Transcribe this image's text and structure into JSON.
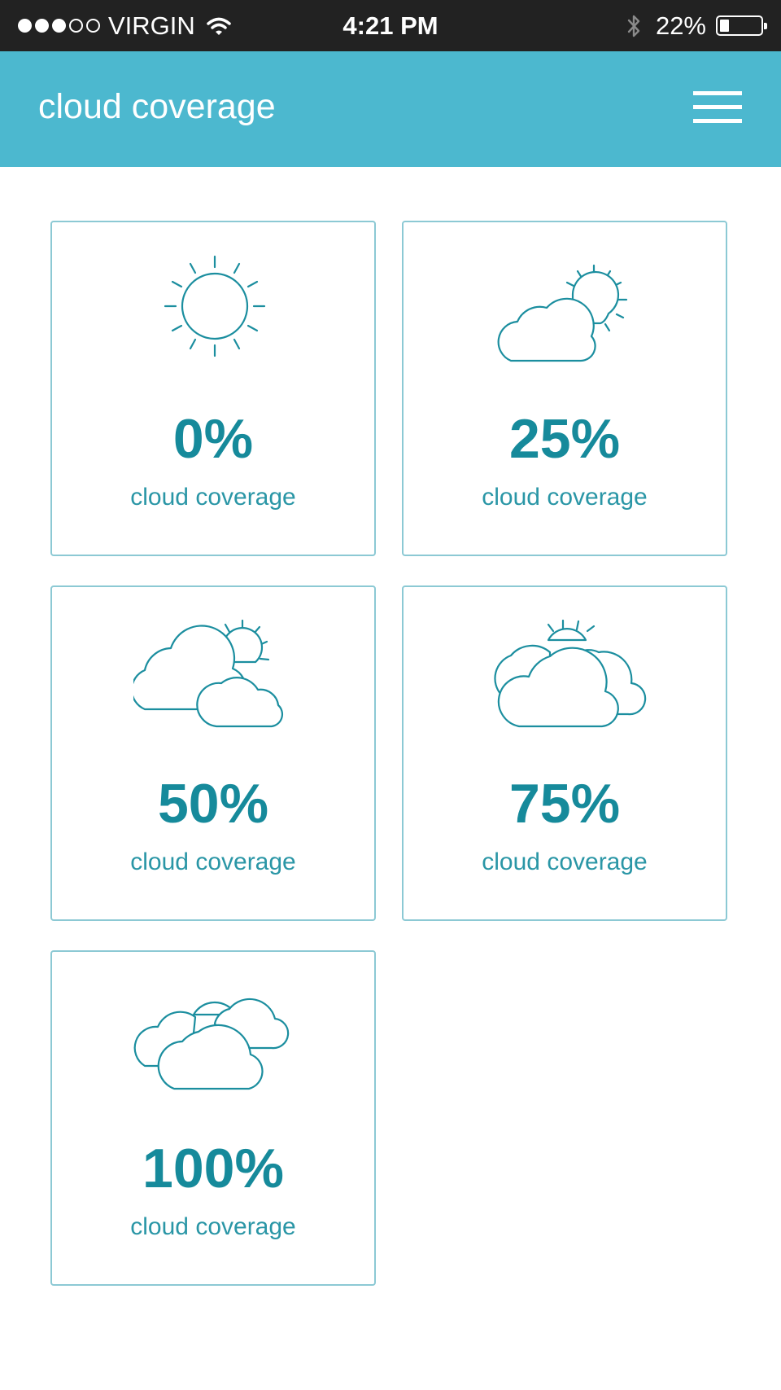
{
  "status_bar": {
    "carrier": "VIRGIN",
    "time": "4:21 PM",
    "battery": "22%",
    "battery_level": 0.22,
    "signal_bars_filled": 3,
    "signal_bars_total": 5
  },
  "header": {
    "title": "cloud coverage",
    "menu_icon": "hamburger-menu-icon"
  },
  "colors": {
    "header_bg": "#4cb8cf",
    "accent": "#168a9b",
    "card_border": "#8cc9d4",
    "status_bar_bg": "#222222"
  },
  "cards": [
    {
      "value": "0%",
      "label": "cloud coverage",
      "icon": "sun-icon"
    },
    {
      "value": "25%",
      "label": "cloud coverage",
      "icon": "partly-sunny-icon"
    },
    {
      "value": "50%",
      "label": "cloud coverage",
      "icon": "sun-behind-two-clouds-icon"
    },
    {
      "value": "75%",
      "label": "cloud coverage",
      "icon": "mostly-cloudy-icon"
    },
    {
      "value": "100%",
      "label": "cloud coverage",
      "icon": "overcast-clouds-icon"
    }
  ]
}
